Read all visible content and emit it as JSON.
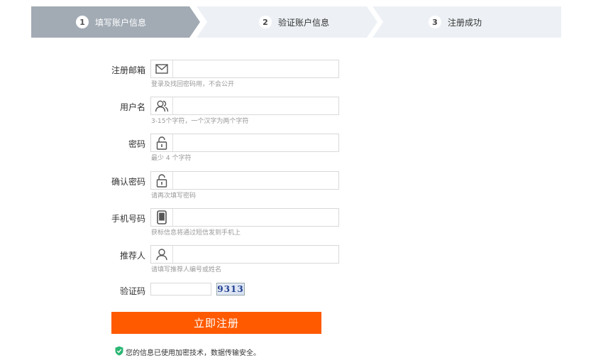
{
  "steps": [
    {
      "num": "1",
      "label": "填写账户信息",
      "active": true
    },
    {
      "num": "2",
      "label": "验证账户信息",
      "active": false
    },
    {
      "num": "3",
      "label": "注册成功",
      "active": false
    }
  ],
  "fields": [
    {
      "label": "注册邮箱",
      "hint": "登录及找回密码用，不会公开",
      "icon": "mail-icon"
    },
    {
      "label": "用户名",
      "hint": "3-15个字符，一个汉字为两个字符",
      "icon": "users-icon"
    },
    {
      "label": "密码",
      "hint": "最少 4 个字符",
      "icon": "lock-icon"
    },
    {
      "label": "确认密码",
      "hint": "请再次填写密码",
      "icon": "lock-icon"
    },
    {
      "label": "手机号码",
      "hint": "获标信息将通过短信发到手机上",
      "icon": "phone-icon"
    },
    {
      "label": "推荐人",
      "hint": "请填写推荐人编号或姓名",
      "icon": "user-icon"
    }
  ],
  "captcha": {
    "label": "验证码",
    "image_text": "9313"
  },
  "submit_label": "立即注册",
  "security_note": "您的信息已使用加密技术，数据传输安全。",
  "colors": {
    "active_step": "#a2abb4",
    "inactive_step": "#edf1f5",
    "submit": "#ff5a00",
    "shield": "#2bb673"
  }
}
